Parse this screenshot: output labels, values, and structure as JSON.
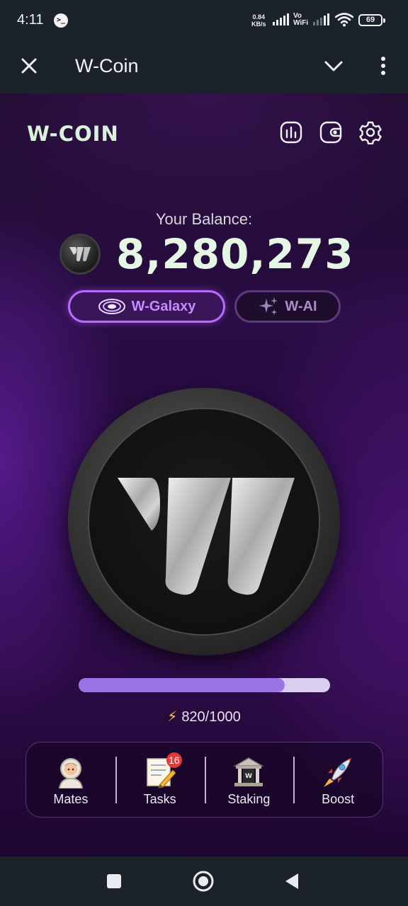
{
  "status_bar": {
    "time": "4:11",
    "net_speed_value": "0.84",
    "net_speed_unit": "KB/s",
    "vo_label": "Vo",
    "wifi_label": "WiFi",
    "battery_level": "69"
  },
  "app_bar": {
    "title": "W-Coin"
  },
  "game": {
    "brand": "W-COIN",
    "balance_label": "Your Balance:",
    "balance_value": "8,280,273",
    "pills": {
      "galaxy": "W-Galaxy",
      "ai": "W-AI"
    },
    "energy": {
      "current": 820,
      "max": 1000,
      "text": "820/1000",
      "fraction": 0.82
    }
  },
  "bottom_nav": {
    "items": [
      {
        "label": "Mates",
        "icon": "astronaut-icon"
      },
      {
        "label": "Tasks",
        "icon": "memo-icon",
        "badge": "16"
      },
      {
        "label": "Staking",
        "icon": "bank-icon"
      },
      {
        "label": "Boost",
        "icon": "rocket-icon"
      }
    ]
  },
  "colors": {
    "accent_purple": "#b86bff",
    "brand_text": "#d8f3da",
    "energy_fill": "#9a74e6",
    "energy_track": "#d9cdf0",
    "badge_red": "#e53935"
  }
}
